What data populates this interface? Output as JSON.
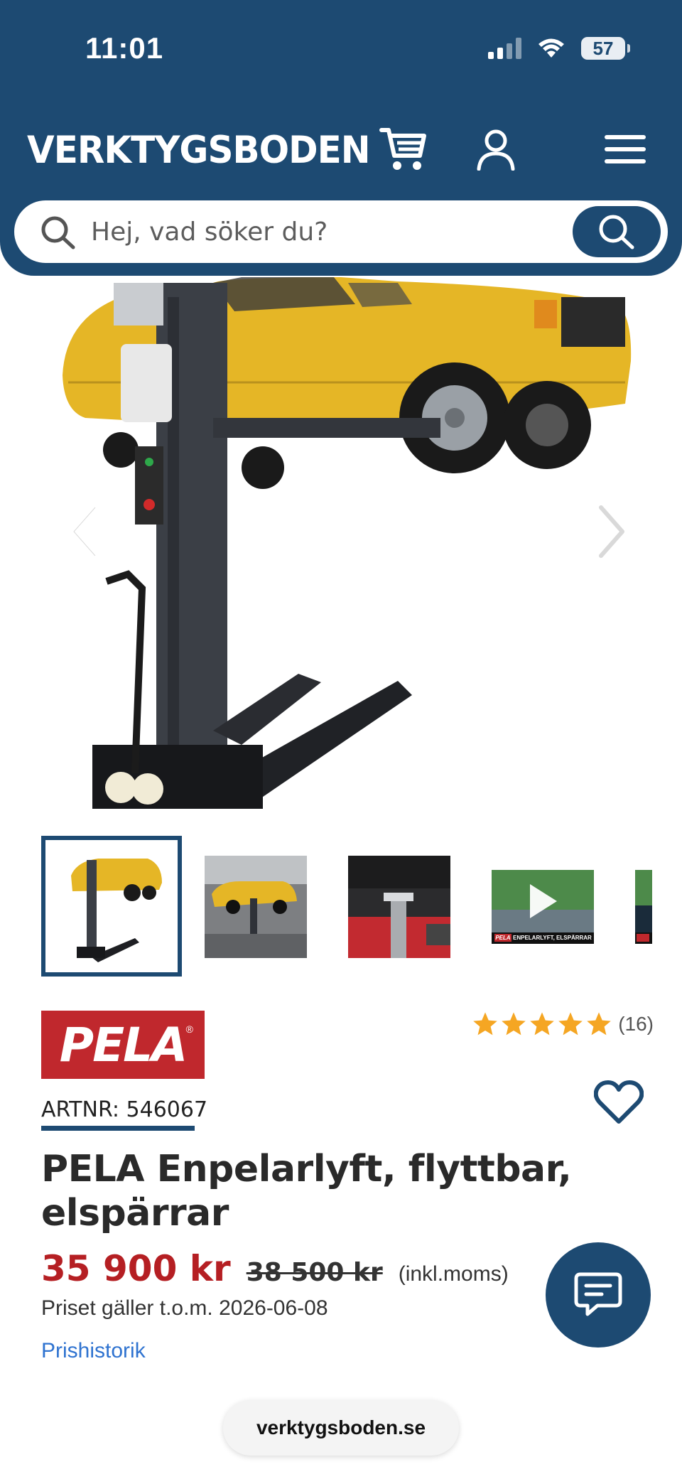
{
  "status_bar": {
    "time": "11:01",
    "battery": "57"
  },
  "header": {
    "brand": "VERKTYGSBODEN",
    "search_placeholder": "Hej, vad söker du?"
  },
  "colors": {
    "brand_blue": "#1d4a72",
    "price_red": "#b51f23",
    "link_blue": "#2f73d0",
    "logo_red": "#c0282d",
    "star_yellow": "#f5a623"
  },
  "icons": [
    "cart-icon",
    "user-icon",
    "menu-icon",
    "search-icon",
    "chevron-left-icon",
    "chevron-right-icon",
    "play-icon",
    "star-icon",
    "heart-icon",
    "chat-icon"
  ],
  "product": {
    "brand_logo": "PELA",
    "brand_logo_mark": "®",
    "rating_count": "(16)",
    "rating_stars": 5,
    "artnr": "ARTNR: 546067",
    "title": "PELA Enpelarlyft, flyttbar, elspärrar",
    "price": "35 900 kr",
    "old_price": "38 500 kr",
    "vat_note": "(inkl.moms)",
    "valid_until": "Priset gäller t.o.m. 2026-06-08",
    "price_history_link": "Prishistorik"
  },
  "thumbnails": {
    "video_caption": "ENPELARLYFT, ELSPÄRRAR",
    "video_logo": "PELA"
  },
  "browser": {
    "url": "verktygsboden.se"
  }
}
